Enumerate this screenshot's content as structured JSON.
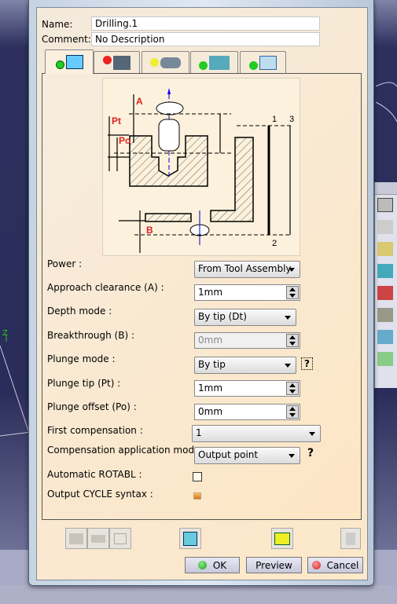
{
  "header": {
    "name_label": "Name:",
    "name_value": "Drilling.1",
    "comment_label": "Comment:",
    "comment_value": "No Description"
  },
  "tabs": [
    {
      "icon": "strategy-parameters-icon",
      "status": "green",
      "active": true
    },
    {
      "icon": "geometry-icon",
      "status": "red"
    },
    {
      "icon": "tool-icon",
      "status": "yellow"
    },
    {
      "icon": "feeds-speeds-icon",
      "status": "green"
    },
    {
      "icon": "macros-icon",
      "status": "green"
    }
  ],
  "diagram": {
    "labels": {
      "a": "A",
      "pt": "Pt",
      "po": "Po",
      "b": "B",
      "n1": "1",
      "n2": "2",
      "n3": "3"
    }
  },
  "form": {
    "power": {
      "label": "Power :",
      "value": "From Tool Assembly"
    },
    "approach": {
      "label": "Approach clearance (A) :",
      "value": "1mm"
    },
    "depth_mode": {
      "label": "Depth mode :",
      "value": "By tip (Dt)"
    },
    "breakthrough": {
      "label": "Breakthrough (B) :",
      "value": "0mm",
      "disabled": true
    },
    "plunge_mode": {
      "label": "Plunge mode :",
      "value": "By tip",
      "help": "?"
    },
    "plunge_tip": {
      "label": "Plunge tip (Pt) :",
      "value": "1mm"
    },
    "plunge_offset": {
      "label": "Plunge offset (Po) :",
      "value": "0mm"
    },
    "first_comp": {
      "label": "First compensation :",
      "value": "1"
    },
    "comp_mode": {
      "label": "Compensation application mode :",
      "value": "Output point",
      "help": "?"
    },
    "auto_rotabl": {
      "label": "Automatic ROTABL :",
      "checked": false
    },
    "output_cycle": {
      "label": "Output CYCLE syntax :",
      "checked": false
    }
  },
  "buttons": {
    "ok": "OK",
    "preview": "Preview",
    "cancel": "Cancel"
  },
  "viewport": {
    "axis_label": "Z"
  },
  "colors": {
    "panel": "#fde8c8",
    "ok_dot": "#1a9a1a",
    "cancel_dot": "#cc2020",
    "label_red": "#e02020"
  }
}
